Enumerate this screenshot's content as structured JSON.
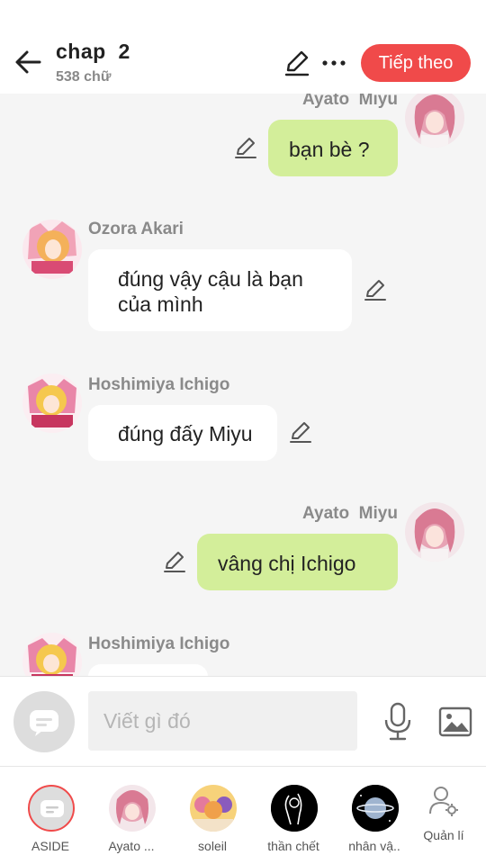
{
  "header": {
    "title": "chap  2",
    "word_count": "538 chữ",
    "next_label": "Tiếp theo",
    "accent": "#f04a4a"
  },
  "messages": [
    {
      "name": "Ayato  Miyu",
      "text": "bạn bè ?"
    },
    {
      "name": "Ozora Akari",
      "text_line1": "đúng vậy cậu là bạn",
      "text_line2": "của mình"
    },
    {
      "name": "Hoshimiya Ichigo",
      "text": "đúng đấy Miyu"
    },
    {
      "name": "Ayato  Miyu",
      "text": "vâng chị Ichigo"
    },
    {
      "name": "Hoshimiya Ichigo"
    }
  ],
  "input": {
    "placeholder": "Viết gì đó",
    "icons": [
      "chat-bubble-icon",
      "microphone-icon",
      "image-icon"
    ]
  },
  "bottom_nav": [
    {
      "label": "ASIDE"
    },
    {
      "label": "Ayato ..."
    },
    {
      "label": "soleil"
    },
    {
      "label": "thần chết"
    },
    {
      "label": "nhân vậ.."
    },
    {
      "label": "Quản lí"
    }
  ],
  "colors": {
    "own_bubble": "#d3ee9a",
    "other_bubble": "#ffffff",
    "chat_bg": "#f5f5f5"
  }
}
